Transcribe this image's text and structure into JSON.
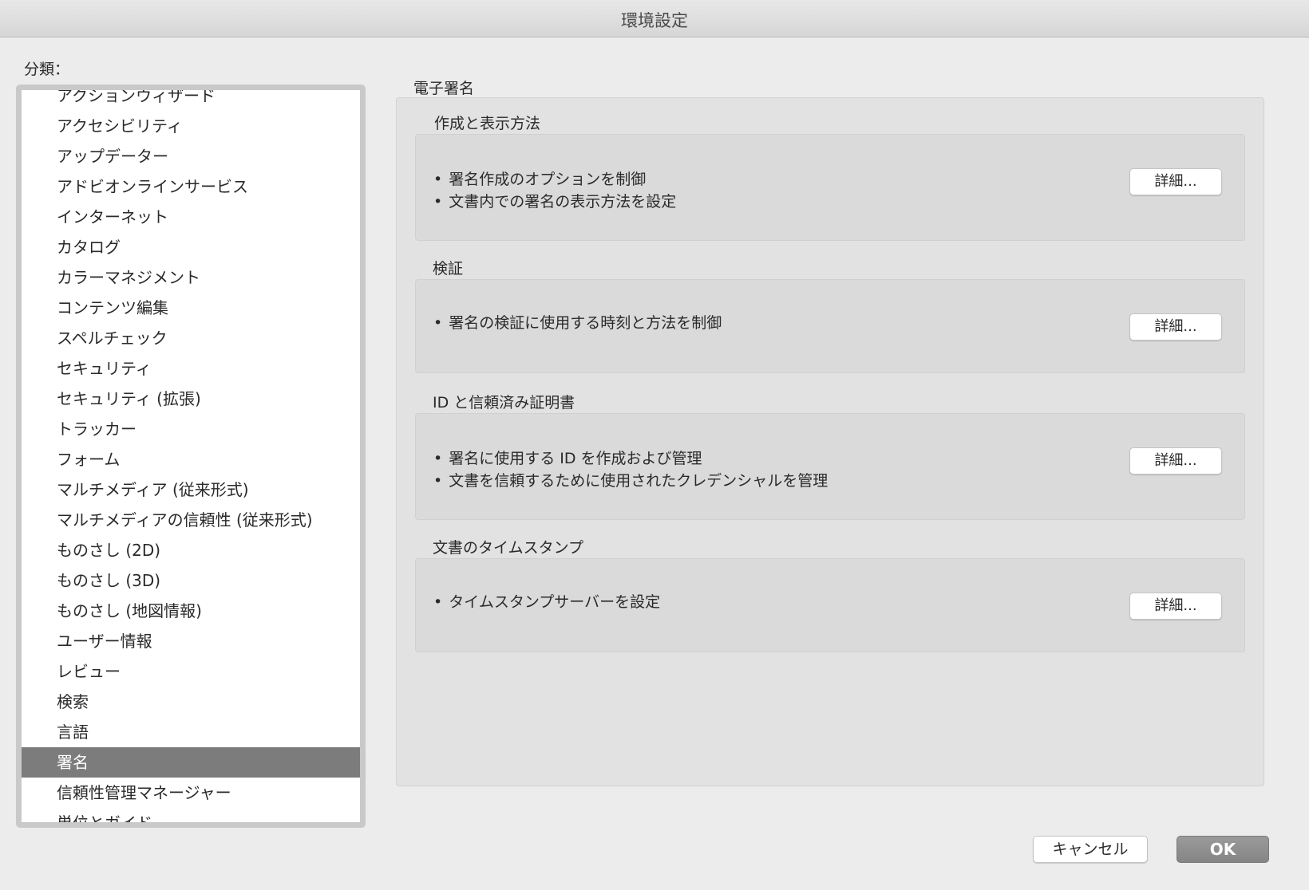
{
  "window": {
    "title": "環境設定"
  },
  "sidebar": {
    "label": "分類：",
    "items": [
      {
        "label": "アクションウィザード",
        "selected": false
      },
      {
        "label": "アクセシビリティ",
        "selected": false
      },
      {
        "label": "アップデーター",
        "selected": false
      },
      {
        "label": "アドビオンラインサービス",
        "selected": false
      },
      {
        "label": "インターネット",
        "selected": false
      },
      {
        "label": "カタログ",
        "selected": false
      },
      {
        "label": "カラーマネジメント",
        "selected": false
      },
      {
        "label": "コンテンツ編集",
        "selected": false
      },
      {
        "label": "スペルチェック",
        "selected": false
      },
      {
        "label": "セキュリティ",
        "selected": false
      },
      {
        "label": "セキュリティ (拡張)",
        "selected": false
      },
      {
        "label": "トラッカー",
        "selected": false
      },
      {
        "label": "フォーム",
        "selected": false
      },
      {
        "label": "マルチメディア (従来形式)",
        "selected": false
      },
      {
        "label": "マルチメディアの信頼性 (従来形式)",
        "selected": false
      },
      {
        "label": "ものさし (2D)",
        "selected": false
      },
      {
        "label": "ものさし (3D)",
        "selected": false
      },
      {
        "label": "ものさし (地図情報)",
        "selected": false
      },
      {
        "label": "ユーザー情報",
        "selected": false
      },
      {
        "label": "レビュー",
        "selected": false
      },
      {
        "label": "検索",
        "selected": false
      },
      {
        "label": "言語",
        "selected": false
      },
      {
        "label": "署名",
        "selected": true
      },
      {
        "label": "信頼性管理マネージャー",
        "selected": false
      },
      {
        "label": "単位とガイド",
        "selected": false
      }
    ]
  },
  "main": {
    "title": "電子署名",
    "groups": [
      {
        "label": "作成と表示方法",
        "bullets": [
          "署名作成のオプションを制御",
          "文書内での署名の表示方法を設定"
        ],
        "button": "詳細..."
      },
      {
        "label": "検証",
        "bullets": [
          "署名の検証に使用する時刻と方法を制御"
        ],
        "button": "詳細..."
      },
      {
        "label": "ID と信頼済み証明書",
        "bullets": [
          "署名に使用する ID を作成および管理",
          "文書を信頼するために使用されたクレデンシャルを管理"
        ],
        "button": "詳細..."
      },
      {
        "label": "文書のタイムスタンプ",
        "bullets": [
          "タイムスタンプサーバーを設定"
        ],
        "button": "詳細..."
      }
    ]
  },
  "footer": {
    "cancel_label": "キャンセル",
    "ok_label": "OK"
  },
  "colors": {
    "selected_row": "#7c7c7c",
    "window_bg": "#ececec",
    "panel_bg": "#e2e2e2"
  }
}
